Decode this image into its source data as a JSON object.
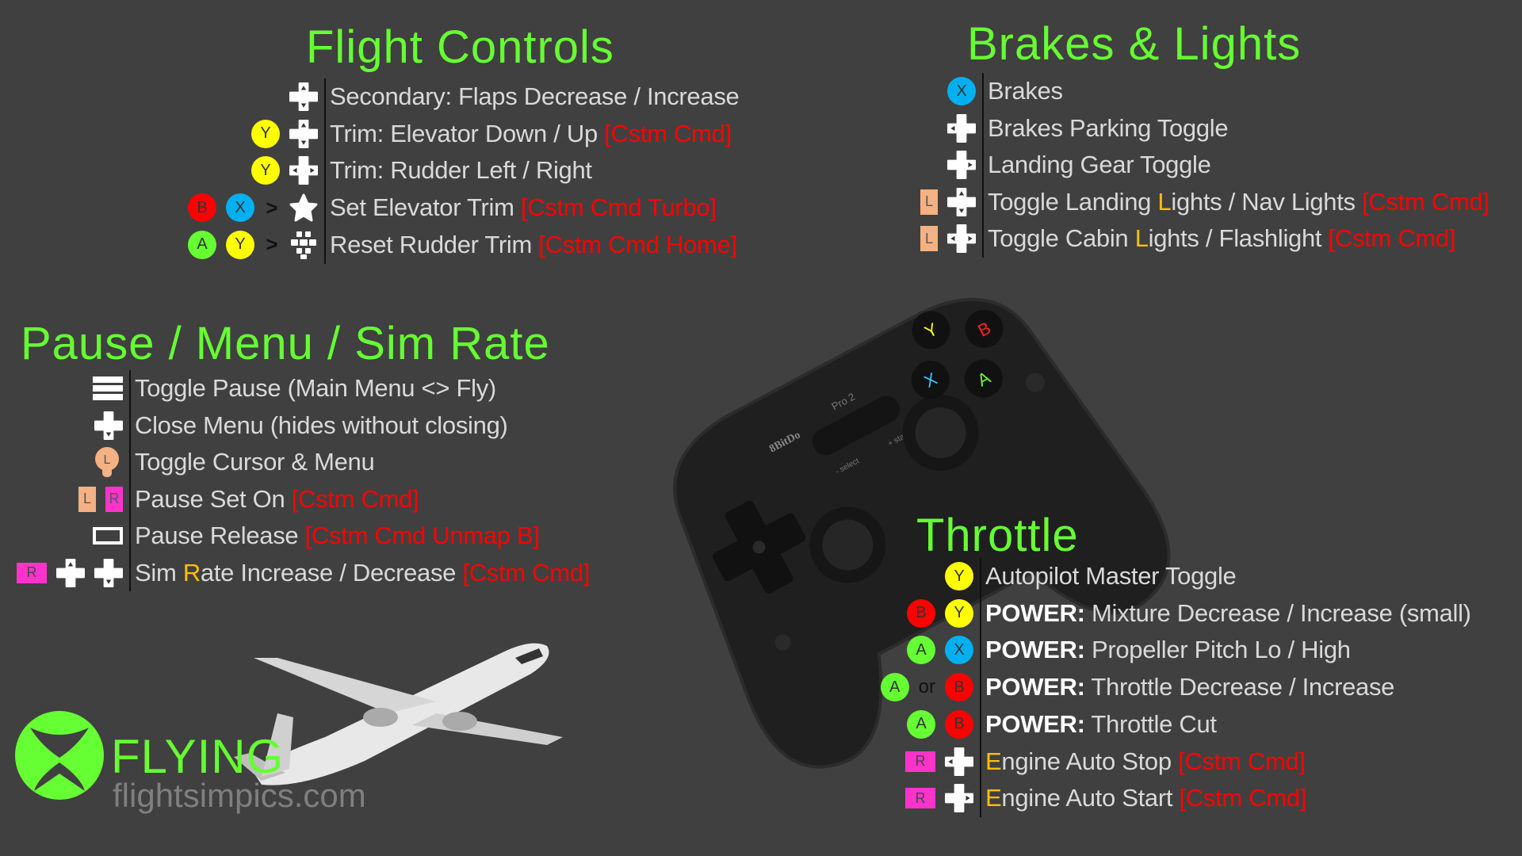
{
  "colors": {
    "title": "#66ff33",
    "text": "#d9d9d9",
    "custom": "#ff0000",
    "accent": "#ffc000",
    "Y": "#ffff00",
    "B": "#ff0000",
    "X": "#00b0f0",
    "A": "#66ff33",
    "L": "#f4b183",
    "R": "#ff33cc"
  },
  "sections": [
    {
      "id": "flight-controls",
      "title": "Flight Controls",
      "rows": [
        {
          "icons": [
            "dpad-up-down"
          ],
          "parts": [
            {
              "t": "Secondary: Flaps Decrease / Increase",
              "s": "n"
            }
          ]
        },
        {
          "icons": [
            "btn-Y",
            "dpad-up-down"
          ],
          "parts": [
            {
              "t": "Trim: Elevator Down / Up ",
              "s": "n"
            },
            {
              "t": "[Cstm Cmd]",
              "s": "c"
            }
          ]
        },
        {
          "icons": [
            "btn-Y",
            "dpad-left-right"
          ],
          "parts": [
            {
              "t": "Trim: Rudder Left / Right",
              "s": "n"
            }
          ]
        },
        {
          "icons": [
            "btn-B",
            "btn-X",
            "then",
            "star"
          ],
          "parts": [
            {
              "t": "Set Elevator Trim ",
              "s": "n"
            },
            {
              "t": "[Cstm Cmd Turbo]",
              "s": "c"
            }
          ]
        },
        {
          "icons": [
            "btn-A",
            "btn-Y",
            "then",
            "home"
          ],
          "parts": [
            {
              "t": "Reset Rudder Trim ",
              "s": "n"
            },
            {
              "t": "[Cstm Cmd Home]",
              "s": "c"
            }
          ]
        }
      ]
    },
    {
      "id": "pause-menu-sim-rate",
      "title": "Pause / Menu / Sim Rate",
      "rows": [
        {
          "icons": [
            "menu"
          ],
          "parts": [
            {
              "t": "Toggle Pause (Main Menu <> Fly)",
              "s": "n"
            }
          ]
        },
        {
          "icons": [
            "dpad-down"
          ],
          "parts": [
            {
              "t": "Close Menu (hides without closing)",
              "s": "n"
            }
          ]
        },
        {
          "icons": [
            "left-stick"
          ],
          "parts": [
            {
              "t": "Toggle Cursor & Menu",
              "s": "n"
            }
          ]
        },
        {
          "icons": [
            "tag-L",
            "tag-R"
          ],
          "parts": [
            {
              "t": "Pause Set On ",
              "s": "n"
            },
            {
              "t": "[Cstm Cmd]",
              "s": "c"
            }
          ]
        },
        {
          "icons": [
            "view"
          ],
          "parts": [
            {
              "t": "Pause Release ",
              "s": "n"
            },
            {
              "t": "[Cstm Cmd Unmap B]",
              "s": "c"
            }
          ]
        },
        {
          "icons": [
            "tagw-R",
            "dpad-up",
            "dpad-down"
          ],
          "parts": [
            {
              "t": "Sim ",
              "s": "n"
            },
            {
              "t": "R",
              "s": "a"
            },
            {
              "t": "ate Increase / Decrease ",
              "s": "n"
            },
            {
              "t": "[Cstm Cmd]",
              "s": "c"
            }
          ]
        }
      ]
    },
    {
      "id": "brakes-lights",
      "title": "Brakes & Lights",
      "rows": [
        {
          "icons": [
            "btn-X"
          ],
          "parts": [
            {
              "t": "Brakes",
              "s": "n"
            }
          ]
        },
        {
          "icons": [
            "dpad-left"
          ],
          "parts": [
            {
              "t": "Brakes Parking Toggle",
              "s": "n"
            }
          ]
        },
        {
          "icons": [
            "dpad-right"
          ],
          "parts": [
            {
              "t": "Landing Gear Toggle",
              "s": "n"
            }
          ]
        },
        {
          "icons": [
            "tag-L",
            "dpad-up-down"
          ],
          "parts": [
            {
              "t": "Toggle Landing ",
              "s": "n"
            },
            {
              "t": "L",
              "s": "a"
            },
            {
              "t": "ights / Nav Lights ",
              "s": "n"
            },
            {
              "t": "[Cstm Cmd]",
              "s": "c"
            }
          ]
        },
        {
          "icons": [
            "tag-L",
            "dpad-left-right"
          ],
          "parts": [
            {
              "t": "Toggle Cabin ",
              "s": "n"
            },
            {
              "t": "L",
              "s": "a"
            },
            {
              "t": "ights / Flashlight ",
              "s": "n"
            },
            {
              "t": "[Cstm Cmd]",
              "s": "c"
            }
          ]
        }
      ]
    },
    {
      "id": "throttle",
      "title": "Throttle",
      "rows": [
        {
          "icons": [
            "btn-Y"
          ],
          "parts": [
            {
              "t": "Autopilot Master Toggle",
              "s": "n"
            }
          ]
        },
        {
          "icons": [
            "btn-B",
            "btn-Y"
          ],
          "parts": [
            {
              "t": "POWER:",
              "s": "b"
            },
            {
              "t": " Mixture Decrease / Increase (small)",
              "s": "n"
            }
          ]
        },
        {
          "icons": [
            "btn-A",
            "btn-X"
          ],
          "parts": [
            {
              "t": "POWER:",
              "s": "b"
            },
            {
              "t": " Propeller Pitch Lo / High",
              "s": "n"
            }
          ]
        },
        {
          "icons": [
            "btn-A",
            "or",
            "btn-B"
          ],
          "parts": [
            {
              "t": "POWER:",
              "s": "b"
            },
            {
              "t": " Throttle Decrease / Increase",
              "s": "n"
            }
          ]
        },
        {
          "icons": [
            "btn-A",
            "btn-B"
          ],
          "parts": [
            {
              "t": "POWER:",
              "s": "b"
            },
            {
              "t": " Throttle Cut",
              "s": "n"
            }
          ]
        },
        {
          "icons": [
            "tagw-R",
            "dpad-left"
          ],
          "parts": [
            {
              "t": "E",
              "s": "a"
            },
            {
              "t": "ngine Auto Stop ",
              "s": "n"
            },
            {
              "t": "[Cstm Cmd]",
              "s": "c"
            }
          ]
        },
        {
          "icons": [
            "tagw-R",
            "dpad-right"
          ],
          "parts": [
            {
              "t": "E",
              "s": "a"
            },
            {
              "t": "ngine Auto Start ",
              "s": "n"
            },
            {
              "t": "[Cstm Cmd]",
              "s": "c"
            }
          ]
        }
      ]
    }
  ],
  "labels": {
    "then": ">",
    "or": "or"
  },
  "controller": {
    "brand": "8BitDo",
    "model": "Pro 2",
    "select": "- select",
    "start": "+ start",
    "face_buttons": [
      "Y",
      "B",
      "X",
      "A"
    ],
    "face_side_labels": [
      "X",
      "A",
      "Y",
      "B"
    ]
  },
  "logo": {
    "brand": "FLYING",
    "site": "flightsimpics.com"
  }
}
